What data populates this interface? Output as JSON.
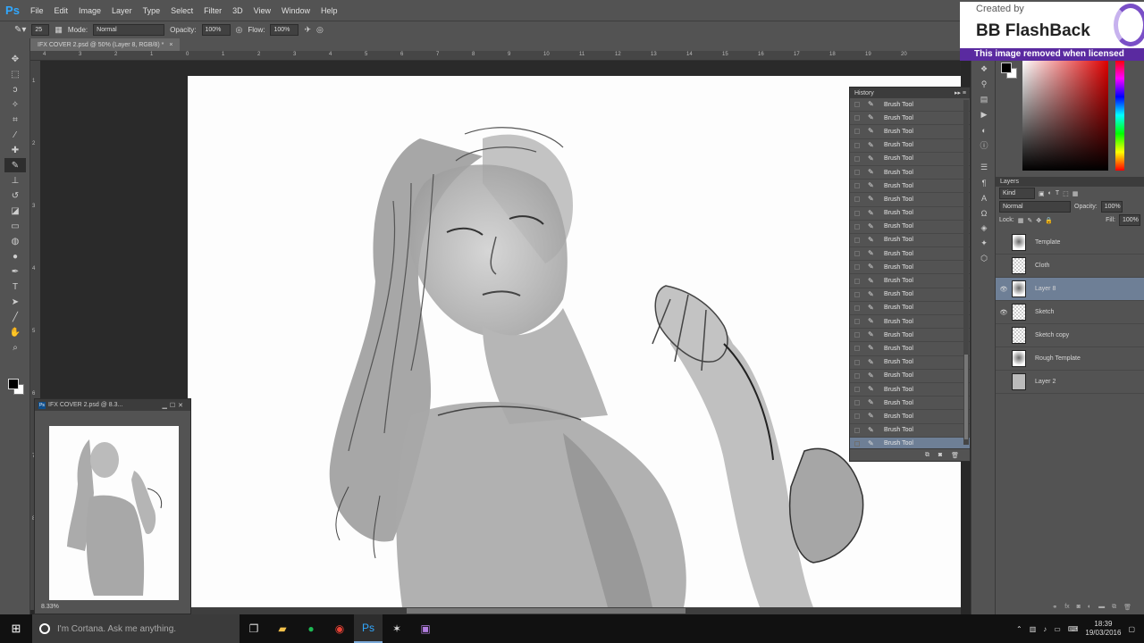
{
  "app": {
    "logo": "Ps"
  },
  "menu": [
    "File",
    "Edit",
    "Image",
    "Layer",
    "Type",
    "Select",
    "Filter",
    "3D",
    "View",
    "Window",
    "Help"
  ],
  "options": {
    "brush_size": "25",
    "mode_label": "Mode:",
    "mode_value": "Normal",
    "opacity_label": "Opacity:",
    "opacity_value": "100%",
    "flow_label": "Flow:",
    "flow_value": "100%"
  },
  "document": {
    "tab_title": "IFX COVER 2.psd @ 50% (Layer 8, RGB/8) *",
    "close": "×"
  },
  "ruler": {
    "top": [
      "4",
      "3",
      "2",
      "1",
      "0",
      "1",
      "2",
      "3",
      "4",
      "5",
      "6",
      "7",
      "8",
      "9",
      "10",
      "11",
      "12",
      "13",
      "14",
      "15",
      "16",
      "17",
      "18",
      "19",
      "20"
    ],
    "left": [
      "1",
      "2",
      "3",
      "4",
      "5",
      "6",
      "7",
      "8"
    ]
  },
  "history": {
    "title": "History",
    "items": [
      "Brush Tool",
      "Brush Tool",
      "Brush Tool",
      "Brush Tool",
      "Brush Tool",
      "Brush Tool",
      "Brush Tool",
      "Brush Tool",
      "Brush Tool",
      "Brush Tool",
      "Brush Tool",
      "Brush Tool",
      "Brush Tool",
      "Brush Tool",
      "Brush Tool",
      "Brush Tool",
      "Brush Tool",
      "Brush Tool",
      "Brush Tool",
      "Brush Tool",
      "Brush Tool",
      "Brush Tool",
      "Brush Tool",
      "Brush Tool",
      "Brush Tool",
      "Brush Tool"
    ],
    "selected_index": 25
  },
  "layers": {
    "title": "Layers",
    "kind_label": "Kind",
    "blend_mode": "Normal",
    "opacity_label": "Opacity:",
    "opacity_value": "100%",
    "lock_label": "Lock:",
    "fill_label": "Fill:",
    "fill_value": "100%",
    "items": [
      {
        "name": "Template",
        "visible": false,
        "thumb": "sketch"
      },
      {
        "name": "Cloth",
        "visible": false,
        "thumb": "checker"
      },
      {
        "name": "Layer 8",
        "visible": true,
        "thumb": "sketch",
        "selected": true
      },
      {
        "name": "Sketch",
        "visible": true,
        "thumb": "checker"
      },
      {
        "name": "Sketch copy",
        "visible": false,
        "thumb": "checker"
      },
      {
        "name": "Rough Template",
        "visible": false,
        "thumb": "sketch"
      },
      {
        "name": "Layer 2",
        "visible": false,
        "thumb": "solid"
      }
    ]
  },
  "navigator": {
    "title": "IFX COVER 2.psd @ 8.3...",
    "zoom": "8.33%"
  },
  "watermark": {
    "created": "Created by",
    "title": "BB FlashBack",
    "strip": "This image removed when licensed"
  },
  "taskbar": {
    "cortana": "I'm Cortana. Ask me anything.",
    "time": "18:39",
    "date": "19/03/2016"
  },
  "colors": {
    "selection": "#6e7f96",
    "panel": "#535353",
    "accent_purple": "#5a2aa0"
  }
}
